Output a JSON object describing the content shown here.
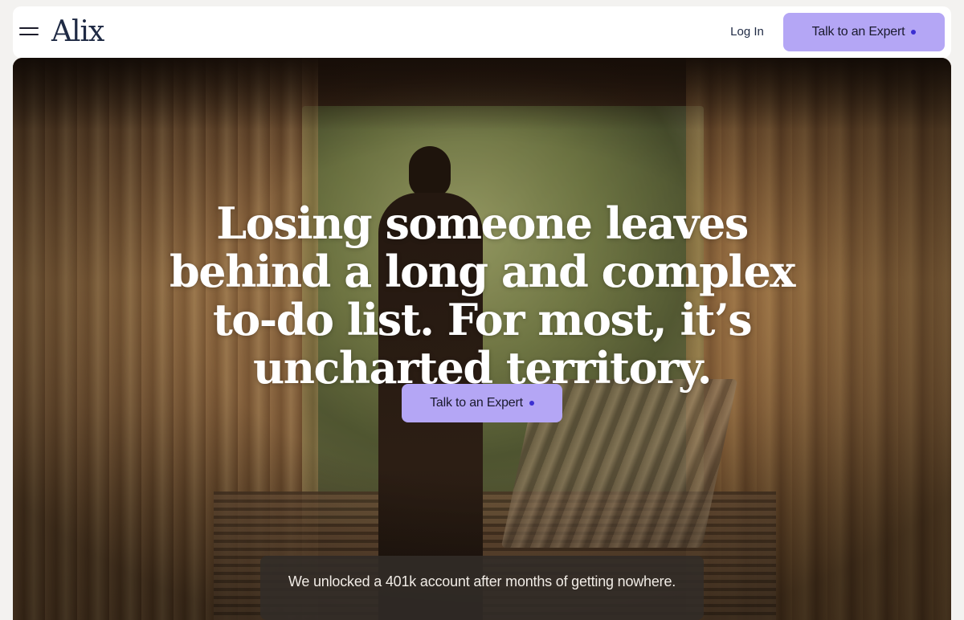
{
  "nav": {
    "logo": "Alix",
    "login_label": "Log In",
    "cta_label": "Talk to an Expert"
  },
  "hero": {
    "headline": "Losing someone leaves behind a long and complex to-do list. For most, it’s uncharted territory.",
    "cta_label": "Talk to an Expert",
    "testimonial": "We unlocked a 401k account after months of getting nowhere."
  },
  "colors": {
    "accent": "#b4a6f5",
    "accent_dot": "#3b2fd1",
    "logo": "#1f2a44"
  },
  "icons": {
    "menu": "hamburger-menu-icon",
    "cta_dot": "dot-icon"
  }
}
